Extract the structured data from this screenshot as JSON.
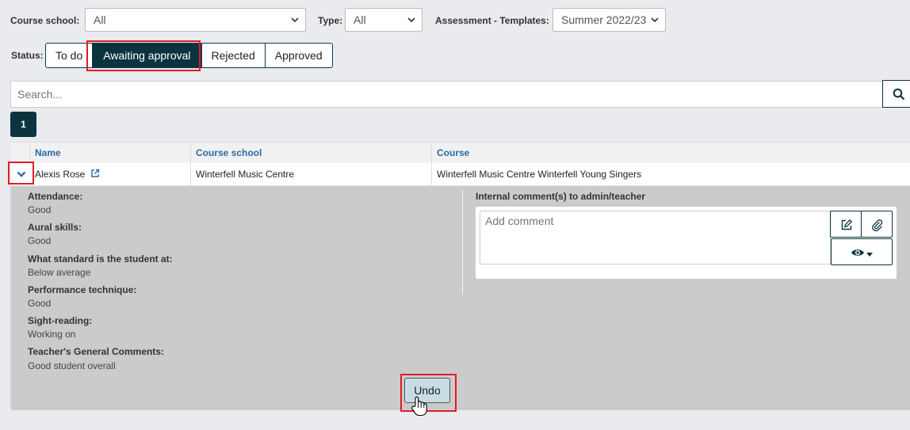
{
  "filters": {
    "course_school_label": "Course school:",
    "course_school_value": "All",
    "type_label": "Type:",
    "type_value": "All",
    "templates_label": "Assessment - Templates:",
    "templates_value": "Summer 2022/23"
  },
  "status": {
    "label": "Status:",
    "buttons": [
      "To do",
      "Awaiting approval",
      "Rejected",
      "Approved"
    ],
    "active": "Awaiting approval"
  },
  "search": {
    "placeholder": "Search..."
  },
  "pagination": {
    "current": "1"
  },
  "table": {
    "headers": [
      "Name",
      "Course school",
      "Course"
    ],
    "rows": [
      {
        "name": "Alexis Rose",
        "course_school": "Winterfell Music Centre",
        "course": "Winterfell Music Centre Winterfell Young Singers"
      }
    ]
  },
  "details": {
    "items": [
      {
        "q": "Attendance:",
        "a": "Good"
      },
      {
        "q": "Aural skills:",
        "a": "Good"
      },
      {
        "q": "What standard is the student at:",
        "a": "Below average"
      },
      {
        "q": "Performance technique:",
        "a": "Good"
      },
      {
        "q": "Sight-reading:",
        "a": "Working on"
      },
      {
        "q": "Teacher's General Comments:",
        "a": "Good student overall"
      }
    ],
    "comments_title": "Internal comment(s) to admin/teacher",
    "comment_placeholder": "Add comment",
    "undo_label": "Undo"
  },
  "colors": {
    "primary": "#0b3440",
    "highlight": "#e31b23",
    "header_text": "#2e6b9e",
    "detail_bg": "#cbcbcb"
  },
  "icons": [
    "chevron-down-icon",
    "external-link-icon",
    "search-icon",
    "edit-icon",
    "paperclip-icon",
    "eye-icon",
    "caret-down-icon",
    "hand-cursor-icon"
  ]
}
